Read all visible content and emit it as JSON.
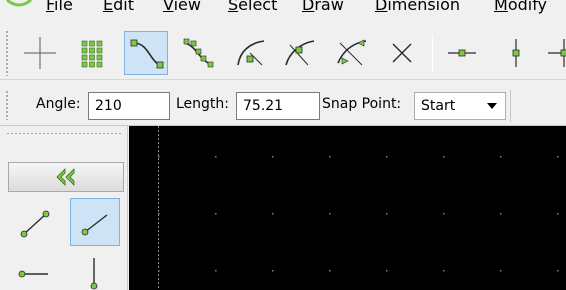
{
  "menubar": {
    "items": [
      {
        "mnemonic": "F",
        "rest": "ile"
      },
      {
        "mnemonic": "E",
        "rest": "dit"
      },
      {
        "mnemonic": "V",
        "rest": "iew"
      },
      {
        "mnemonic": "S",
        "rest": "elect"
      },
      {
        "mnemonic": "D",
        "rest": "raw"
      },
      {
        "mnemonic": "D",
        "rest": "imension"
      },
      {
        "mnemonic": "M",
        "rest": "odify"
      }
    ]
  },
  "toolbar": {
    "icons": [
      "crosshair-icon",
      "snap-grid-icon",
      "snap-endpoint-icon",
      "snap-on-entity-icon",
      "snap-center-icon",
      "snap-middle-icon",
      "snap-distance-icon",
      "snap-intersection-icon",
      "restrict-horizontal-icon",
      "restrict-vertical-icon",
      "restrict-orthogonal-icon"
    ],
    "active_index": 2
  },
  "options": {
    "angle_label": "Angle:",
    "angle_value": "210",
    "length_label": "Length:",
    "length_value": "75.21",
    "snap_point_label": "Snap Point:",
    "snap_point_value": "Start"
  },
  "tool_panel": {
    "back_icon": "double-chevron-left-icon",
    "tools": [
      "line-2points-icon",
      "line-angle-icon",
      "line-horizontal-icon",
      "line-vertical-icon"
    ],
    "active_index": 1
  },
  "colors": {
    "accent_green": "#7ac943",
    "active_bg": "#cfe3f6",
    "active_border": "#7fb2e2",
    "canvas_bg": "#000000",
    "grid_dot": "#7f7f7f"
  }
}
